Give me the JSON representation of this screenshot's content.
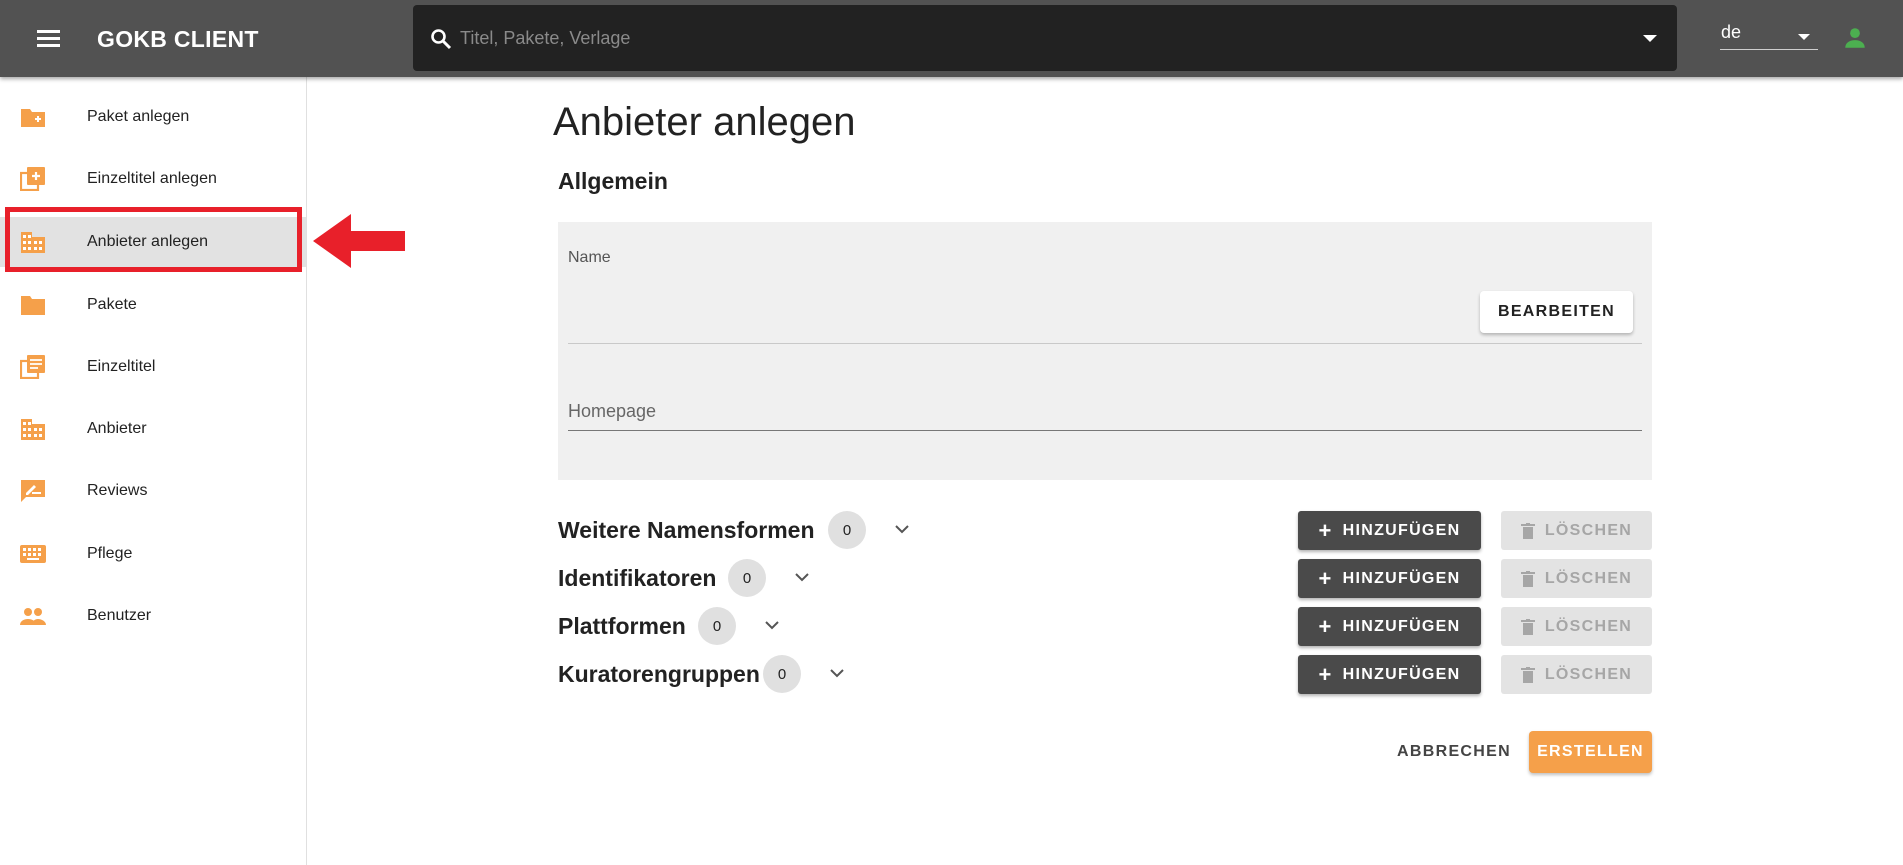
{
  "header": {
    "app_title": "GOKB CLIENT",
    "search_placeholder": "Titel, Pakete, Verlage",
    "search_value": "",
    "language": "de"
  },
  "sidebar": {
    "items": [
      {
        "label": "Paket anlegen",
        "icon": "folder-add-icon"
      },
      {
        "label": "Einzeltitel anlegen",
        "icon": "library-add-icon"
      },
      {
        "label": "Anbieter anlegen",
        "icon": "domain-icon",
        "active": true
      },
      {
        "label": "Pakete",
        "icon": "folder-icon"
      },
      {
        "label": "Einzeltitel",
        "icon": "library-books-icon"
      },
      {
        "label": "Anbieter",
        "icon": "domain-icon"
      },
      {
        "label": "Reviews",
        "icon": "rate-review-icon"
      },
      {
        "label": "Pflege",
        "icon": "keyboard-icon"
      },
      {
        "label": "Benutzer",
        "icon": "people-icon"
      }
    ]
  },
  "main": {
    "page_title": "Anbieter anlegen",
    "section_title": "Allgemein",
    "name_label": "Name",
    "name_value": "",
    "edit_button": "BEARBEITEN",
    "homepage_label": "Homepage",
    "homepage_value": "",
    "rows": [
      {
        "title": "Weitere Namensformen",
        "count": "0",
        "add": "HINZUFÜGEN",
        "delete": "LÖSCHEN"
      },
      {
        "title": "Identifikatoren",
        "count": "0",
        "add": "HINZUFÜGEN",
        "delete": "LÖSCHEN"
      },
      {
        "title": "Plattformen",
        "count": "0",
        "add": "HINZUFÜGEN",
        "delete": "LÖSCHEN"
      },
      {
        "title": "Kuratorengruppen",
        "count": "0",
        "add": "HINZUFÜGEN",
        "delete": "LÖSCHEN"
      }
    ],
    "cancel_button": "ABBRECHEN",
    "create_button": "ERSTELLEN"
  },
  "colors": {
    "accent": "#f5a04a",
    "topbar": "#525252",
    "search_bg": "#222222",
    "highlight": "#e8202a",
    "user_icon": "#4caf50"
  }
}
